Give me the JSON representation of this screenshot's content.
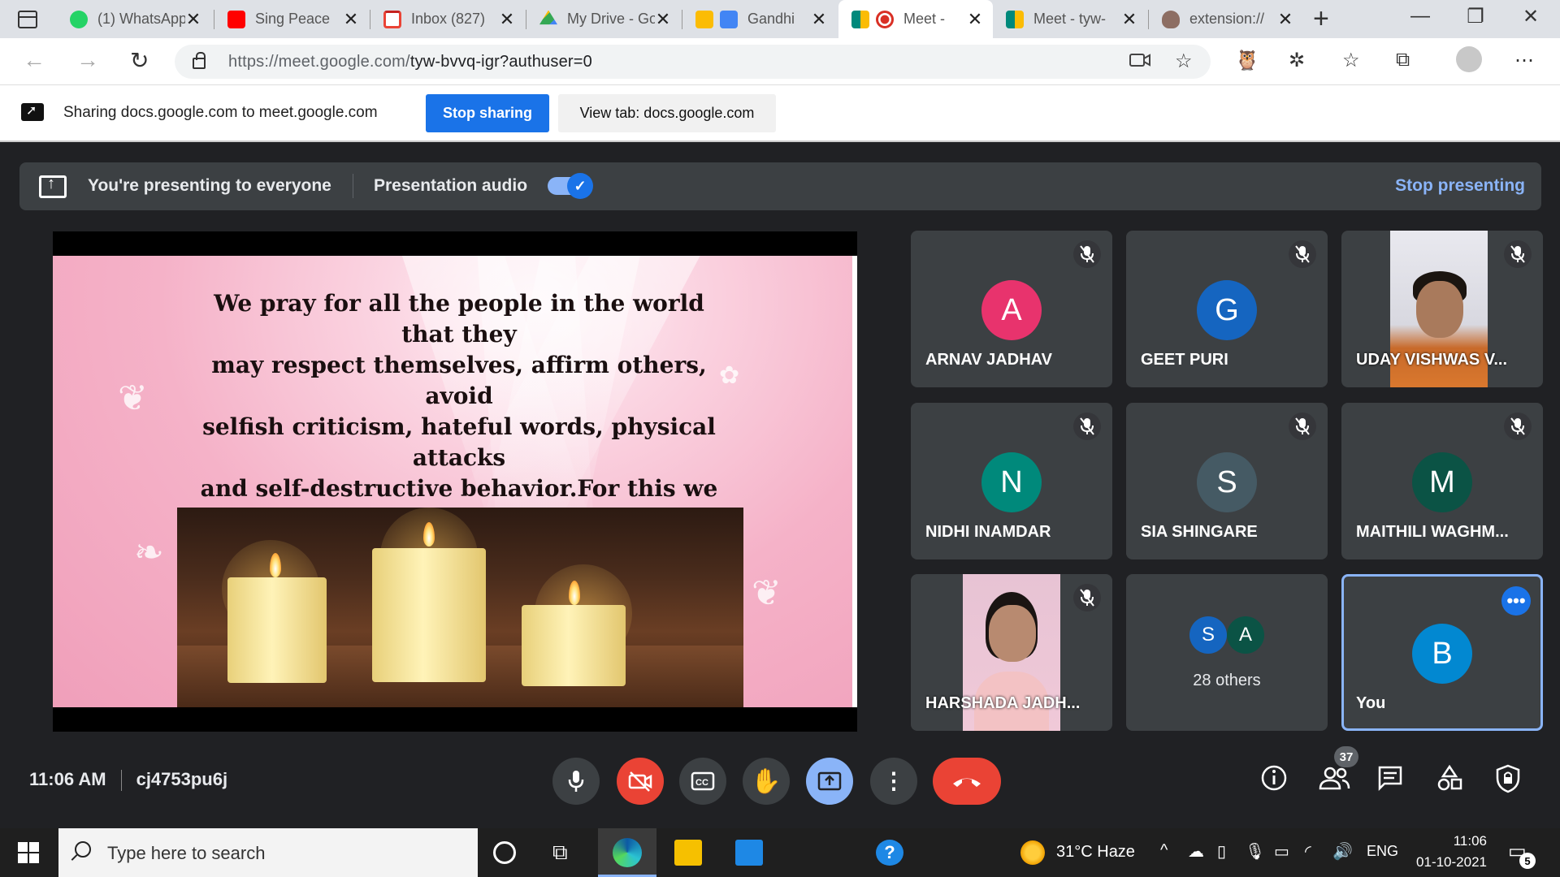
{
  "browser": {
    "tabs": [
      {
        "title": "(1) WhatsApp",
        "favicon_color": "#25d366"
      },
      {
        "title": "Sing Peace",
        "favicon_color": "#ff0000"
      },
      {
        "title": "Inbox (827)",
        "favicon_color": "#ea4335"
      },
      {
        "title": "My Drive - Google Drive",
        "favicon_color": "#fbbc04"
      },
      {
        "title": "Gandhi",
        "favicon_color": "#4285f4"
      },
      {
        "title": "Meet -",
        "favicon_color": "#d93025"
      },
      {
        "title": "Meet - tyw-",
        "favicon_color": "#00897b"
      },
      {
        "title": "extension://",
        "favicon_color": "#8d6e63"
      }
    ],
    "active_tab_index": 5,
    "url_host": "https://meet.google.com/",
    "url_path": "tyw-bvvq-igr?authuser=0"
  },
  "sharing_bar": {
    "text": "Sharing docs.google.com to meet.google.com",
    "stop_sharing_label": "Stop sharing",
    "view_tab_label": "View tab: docs.google.com"
  },
  "presenting_banner": {
    "label": "You're presenting to everyone",
    "audio_label": "Presentation audio",
    "audio_enabled": true,
    "stop_label": "Stop presenting"
  },
  "slide": {
    "prayer_text": "We pray for all the people in the world that they\nmay respect themselves, affirm others, avoid\nselfish criticism, hateful words, physical attacks\nand self-destructive behavior.For this we pray to\nthe Lord.\n(Response)"
  },
  "participants": [
    {
      "name": "ARNAV JADHAV",
      "initial": "A",
      "color": "#e8336d",
      "muted": true
    },
    {
      "name": "GEET PURI",
      "initial": "G",
      "color": "#1565c0",
      "muted": true
    },
    {
      "name": "UDAY VISHWAS V...",
      "initial": "",
      "video": true,
      "muted": true
    },
    {
      "name": "NIDHI INAMDAR",
      "initial": "N",
      "color": "#00897b",
      "muted": true
    },
    {
      "name": "SIA SHINGARE",
      "initial": "S",
      "color": "#455a64",
      "muted": true
    },
    {
      "name": "MAITHILI WAGHM...",
      "initial": "M",
      "color": "#0b5345",
      "muted": true
    },
    {
      "name": "HARSHADA JADH...",
      "initial": "",
      "video": true,
      "muted": true
    }
  ],
  "others_tile": {
    "initials": [
      "S",
      "A"
    ],
    "colors": [
      "#1565c0",
      "#0b5345"
    ],
    "label": "28 others"
  },
  "you_tile": {
    "initial": "B",
    "color": "#0288d1",
    "label": "You"
  },
  "meeting": {
    "time": "11:06 AM",
    "code": "cj4753pu6j",
    "participant_count": "37"
  },
  "controls": [
    "mic-button",
    "camera-off-button",
    "captions-button",
    "raise-hand-button",
    "present-button",
    "more-options-button",
    "leave-call-button"
  ],
  "taskbar": {
    "search_placeholder": "Type here to search",
    "weather": "31°C  Haze",
    "language": "ENG",
    "clock_time": "11:06",
    "clock_date": "01-10-2021",
    "notification_count": "5"
  }
}
